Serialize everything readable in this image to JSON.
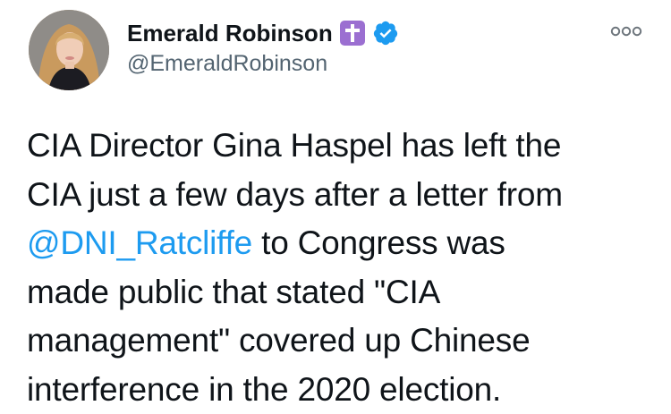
{
  "author": {
    "display_name": "Emerald Robinson",
    "handle": "@EmeraldRobinson",
    "badge_emoji": "latin-cross-emoji",
    "verified": true,
    "verified_color": "#1d9bf0"
  },
  "tweet": {
    "lines": [
      {
        "text": "CIA Director Gina Haspel has left the"
      },
      {
        "text": "CIA just a few days after a letter from"
      },
      {
        "mention": "@DNI_Ratcliffe",
        "text": " to Congress was"
      },
      {
        "text": "made public that stated \"CIA"
      },
      {
        "text": "management\" covered up Chinese"
      },
      {
        "text": "interference in the 2020 election."
      }
    ]
  },
  "colors": {
    "text": "#0f1419",
    "secondary_text": "#536471",
    "link": "#1d9bf0",
    "emoji_purple": "#9b6fd1"
  },
  "icons": {
    "more": "more-options-icon",
    "verified": "verified-badge-icon"
  }
}
